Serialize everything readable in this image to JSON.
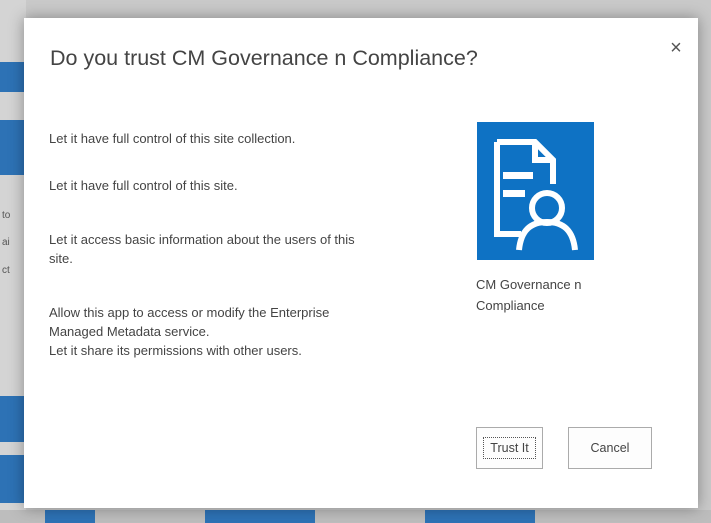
{
  "background": {
    "left_fragments": [
      "to",
      "ai",
      "ct"
    ]
  },
  "dialog": {
    "title": "Do you trust CM Governance n Compliance?",
    "close_symbol": "×",
    "permissions": [
      [
        "Let it have full control of this site collection."
      ],
      [
        "Let it have full control of this site."
      ],
      [
        "Let it access basic information about the users of this",
        "site."
      ],
      [
        "Allow this app to access or modify the Enterprise",
        "Managed Metadata service.",
        "Let it share its permissions with other users."
      ]
    ],
    "app": {
      "icon": "document-user-icon",
      "tile_color": "#0e72c4",
      "name_line1": "CM Governance n",
      "name_line2": "Compliance"
    },
    "buttons": {
      "trust": "Trust It",
      "cancel": "Cancel"
    }
  }
}
